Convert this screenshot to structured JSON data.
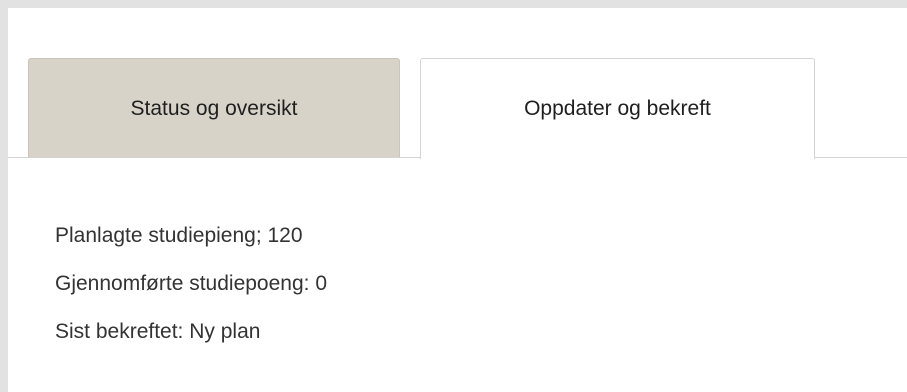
{
  "tabs": {
    "status_label": "Status og oversikt",
    "update_label": "Oppdater og bekreft",
    "active": "Oppdater og bekreft"
  },
  "summary": {
    "planned_credits": "Planlagte studiepieng; 120",
    "completed_credits": "Gjennomførte studiepoeng: 0",
    "last_confirmed": "Sist bekreftet: Ny plan"
  },
  "colors": {
    "page_background": "#e2e2e2",
    "inactive_tab": "#d7d3c8",
    "active_tab": "#ffffff",
    "text": "#333333"
  }
}
